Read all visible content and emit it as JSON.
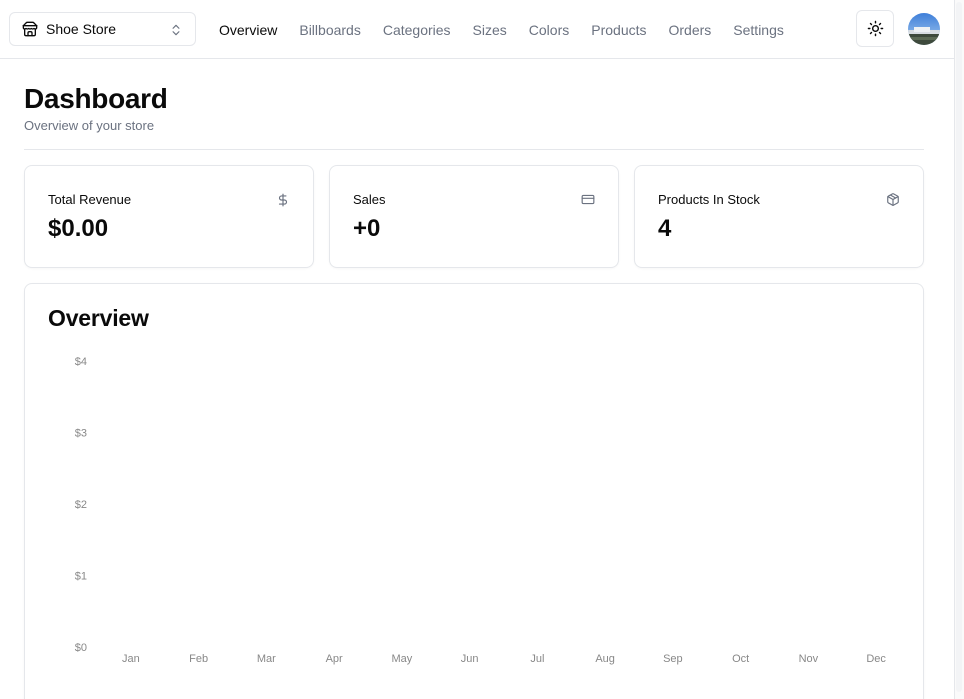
{
  "nav": {
    "store_name": "Shoe Store",
    "links": [
      "Overview",
      "Billboards",
      "Categories",
      "Sizes",
      "Colors",
      "Products",
      "Orders",
      "Settings"
    ],
    "active": "Overview"
  },
  "header": {
    "title": "Dashboard",
    "subtitle": "Overview of your store"
  },
  "stats": [
    {
      "label": "Total Revenue",
      "value": "$0.00",
      "icon": "dollar-icon"
    },
    {
      "label": "Sales",
      "value": "+0",
      "icon": "credit-card-icon"
    },
    {
      "label": "Products In Stock",
      "value": "4",
      "icon": "package-icon"
    }
  ],
  "overview": {
    "title": "Overview"
  },
  "chart_data": {
    "type": "bar",
    "title": "Overview",
    "categories": [
      "Jan",
      "Feb",
      "Mar",
      "Apr",
      "May",
      "Jun",
      "Jul",
      "Aug",
      "Sep",
      "Oct",
      "Nov",
      "Dec"
    ],
    "values": [
      0,
      0,
      0,
      0,
      0,
      0,
      0,
      0,
      0,
      0,
      0,
      0
    ],
    "y_ticks": [
      "$0",
      "$1",
      "$2",
      "$3",
      "$4"
    ],
    "ylim": [
      0,
      4
    ],
    "grid": false
  },
  "colors": {
    "muted_text": "#6b7280",
    "border": "#e5e7eb",
    "foreground": "#0a0a0a",
    "tick_text": "#888888"
  }
}
